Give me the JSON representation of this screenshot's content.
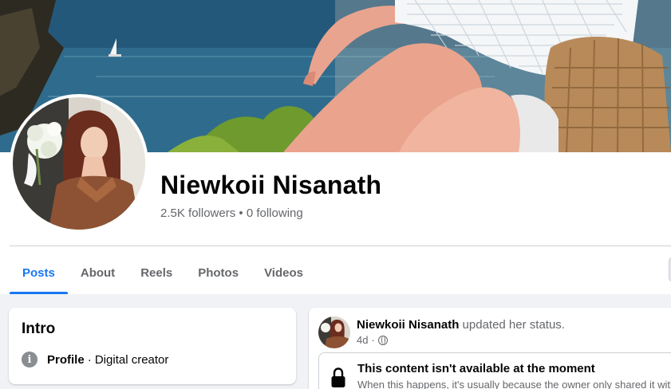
{
  "profile": {
    "name": "Niewkoii Nisanath",
    "followers": "2.5K followers",
    "separator": "•",
    "following": "0 following"
  },
  "tabs": [
    {
      "label": "Posts",
      "active": true
    },
    {
      "label": "About",
      "active": false
    },
    {
      "label": "Reels",
      "active": false
    },
    {
      "label": "Photos",
      "active": false
    },
    {
      "label": "Videos",
      "active": false
    }
  ],
  "intro": {
    "title": "Intro",
    "icon": "info-icon",
    "row_label": "Profile",
    "row_value": "· Digital creator"
  },
  "post": {
    "author": "Niewkoii Nisanath",
    "action": "updated her status.",
    "time": "4d",
    "time_separator": "·",
    "audience_icon": "globe-icon",
    "notice_title": "This content isn't available at the moment",
    "notice_text": "When this happens, it's usually because the owner only shared it with"
  },
  "colors": {
    "accent": "#1877f2",
    "secondary_text": "#65676b",
    "background": "#f0f2f5",
    "divider": "#ced0d4"
  }
}
